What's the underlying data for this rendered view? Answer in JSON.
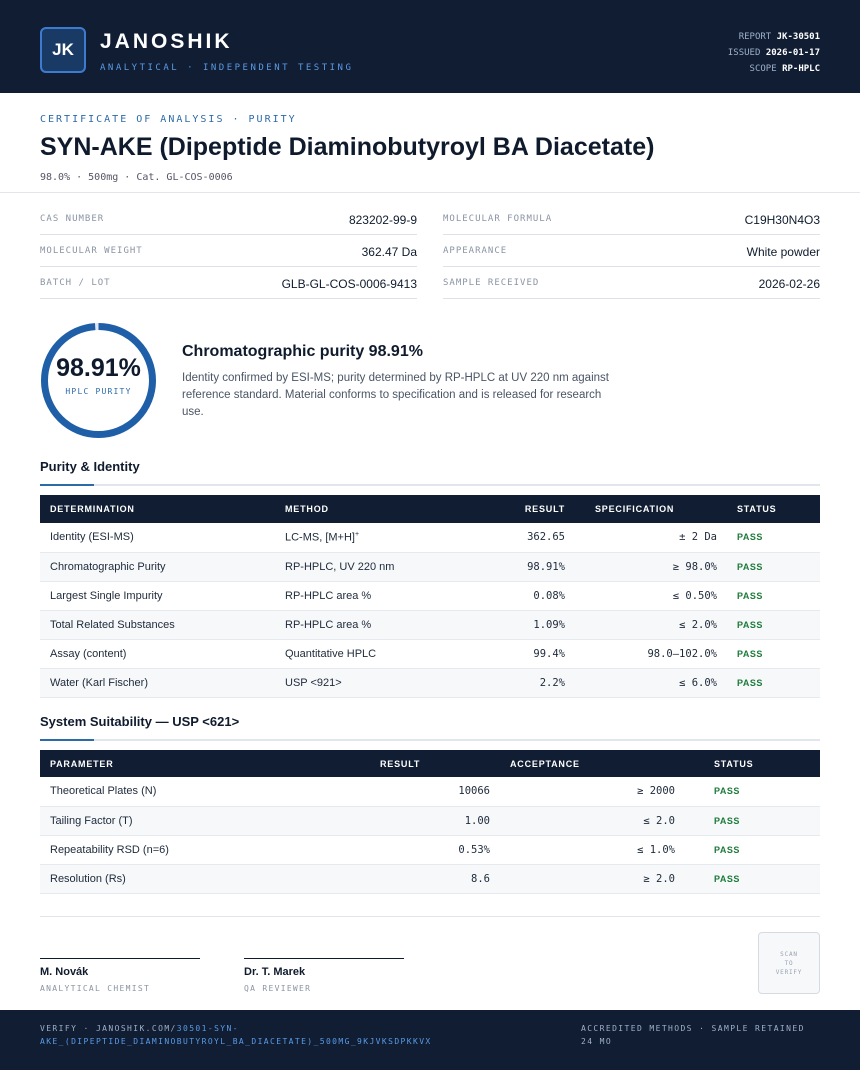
{
  "header": {
    "logo_initials": "JK",
    "brand": "JANOSHIK",
    "tagline": "ANALYTICAL · INDEPENDENT TESTING",
    "report_label": "REPORT",
    "report_value": "JK-30501",
    "issued_label": "ISSUED",
    "issued_value": "2026-01-17",
    "scope_label": "SCOPE",
    "scope_value": "RP-HPLC"
  },
  "document": {
    "kicker": "CERTIFICATE OF ANALYSIS · PURITY",
    "title": "SYN-AKE (Dipeptide Diaminobutyroyl BA Diacetate)",
    "subtitle": "98.0% · 500mg  ·  Cat. GL-COS-0006"
  },
  "info": {
    "cas_label": "CAS NUMBER",
    "cas_value": "823202-99-9",
    "formula_label": "MOLECULAR FORMULA",
    "formula_value": "C19H30N4O3",
    "mw_label": "MOLECULAR WEIGHT",
    "mw_value": "362.47 Da",
    "appearance_label": "APPEARANCE",
    "appearance_value": "White powder",
    "batch_label": "BATCH / LOT",
    "batch_value": "GLB-GL-COS-0006-9413",
    "received_label": "SAMPLE RECEIVED",
    "received_value": "2026-02-26"
  },
  "purity": {
    "value": "98.91%",
    "fraction": 0.9891,
    "ring_label": "HPLC PURITY",
    "headline": "Chromatographic purity 98.91%",
    "description": "Identity confirmed by ESI-MS; purity determined by RP-HPLC at UV 220 nm against reference standard. Material conforms to specification and is released for research use.",
    "ring_color": "#1f5fa8"
  },
  "purity_identity": {
    "title": "Purity & Identity",
    "headers": [
      "DETERMINATION",
      "METHOD",
      "RESULT",
      "SPECIFICATION",
      "STATUS"
    ],
    "rows": [
      {
        "determination": "Identity (ESI-MS)",
        "method": "LC-MS, [M+H]",
        "method_sup": "+",
        "result": "362.65",
        "spec": "± 2 Da",
        "status": "PASS"
      },
      {
        "determination": "Chromatographic Purity",
        "method": "RP-HPLC, UV 220 nm",
        "method_sup": "",
        "result": "98.91%",
        "spec": "≥ 98.0%",
        "status": "PASS"
      },
      {
        "determination": "Largest Single Impurity",
        "method": "RP-HPLC area %",
        "method_sup": "",
        "result": "0.08%",
        "spec": "≤ 0.50%",
        "status": "PASS"
      },
      {
        "determination": "Total Related Substances",
        "method": "RP-HPLC area %",
        "method_sup": "",
        "result": "1.09%",
        "spec": "≤ 2.0%",
        "status": "PASS"
      },
      {
        "determination": "Assay (content)",
        "method": "Quantitative HPLC",
        "method_sup": "",
        "result": "99.4%",
        "spec": "98.0–102.0%",
        "status": "PASS"
      },
      {
        "determination": "Water (Karl Fischer)",
        "method": "USP <921>",
        "method_sup": "",
        "result": "2.2%",
        "spec": "≤ 6.0%",
        "status": "PASS"
      }
    ]
  },
  "system_suitability": {
    "title": "System Suitability — USP <621>",
    "headers": [
      "PARAMETER",
      "RESULT",
      "ACCEPTANCE",
      "STATUS"
    ],
    "rows": [
      {
        "parameter": "Theoretical Plates (N)",
        "result": "10066",
        "acceptance": "≥ 2000",
        "status": "PASS"
      },
      {
        "parameter": "Tailing Factor (T)",
        "result": "1.00",
        "acceptance": "≤ 2.0",
        "status": "PASS"
      },
      {
        "parameter": "Repeatability RSD (n=6)",
        "result": "0.53%",
        "acceptance": "≤ 1.0%",
        "status": "PASS"
      },
      {
        "parameter": "Resolution (Rs)",
        "result": "8.6",
        "acceptance": "≥ 2.0",
        "status": "PASS"
      }
    ]
  },
  "signatures": [
    {
      "name": "M. Novák",
      "role": "ANALYTICAL CHEMIST"
    },
    {
      "name": "Dr. T. Marek",
      "role": "QA REVIEWER"
    }
  ],
  "qr": {
    "line1": "SCAN",
    "line2": "TO",
    "line3": "VERIFY"
  },
  "footer": {
    "verify_prefix": "VERIFY · JANOSHIK.COM/",
    "verify_url": "30501-SYN-AKE_(DIPEPTIDE_DIAMINOBUTYROYL_BA_DIACETATE)_500MG_9KJVKSDPKKVX",
    "right_text": "ACCREDITED METHODS · SAMPLE RETAINED 24 MO"
  }
}
